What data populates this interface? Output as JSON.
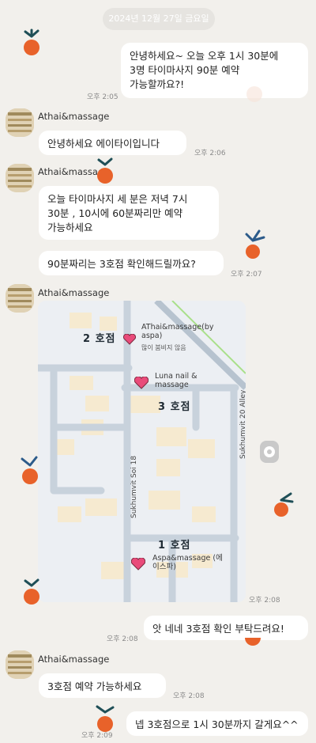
{
  "date_header": "2024년 12월 27일 금요일",
  "shop_name": "Athai&massage",
  "messages": [
    {
      "text": "안녕하세요~ 오늘 오후 1시 30분에\n3명 타이마사지 90분 예약\n가능할까요?!",
      "time": "오후 2:05"
    },
    {
      "text": "안녕하세요 에이타이입니다",
      "time": "오후 2:06"
    },
    {
      "text": "오늘 타이마사지 세 분은 저녁 7시\n30분 , 10시에 60분짜리만 예약\n가능하세요",
      "time": ""
    },
    {
      "text": "90분짜리는 3호점 확인해드릴까요?",
      "time": "오후 2:07"
    },
    {
      "text": "",
      "time": "오후 2:08"
    },
    {
      "text": "앗 네네 3호점 확인 부탁드려요!",
      "time": "오후 2:08"
    },
    {
      "text": "3호점 예약 가능하세요",
      "time": "오후 2:08"
    },
    {
      "text": "넵 3호점으로 1시 30분까지 갈게요^^",
      "time": "오후 2:09"
    }
  ],
  "map": {
    "branch2": {
      "num": "2 호점",
      "label": "AThai&massage(by\naspa)",
      "sub": "많이 붐비지 않음"
    },
    "branch3": {
      "num": "3 호점",
      "label": "Luna nail &\nmassage"
    },
    "branch1": {
      "num": "1 호점",
      "label": "Aspa&massage (에\n이스파)"
    },
    "street1": "Sukhumvit Soi 18",
    "street2": "Sukhumvit 20 Alley"
  },
  "colors": {
    "background": "#f2f0ec",
    "bubble": "#ffffff",
    "pin": "#e94b7a",
    "tangerine": "#e8622a"
  }
}
